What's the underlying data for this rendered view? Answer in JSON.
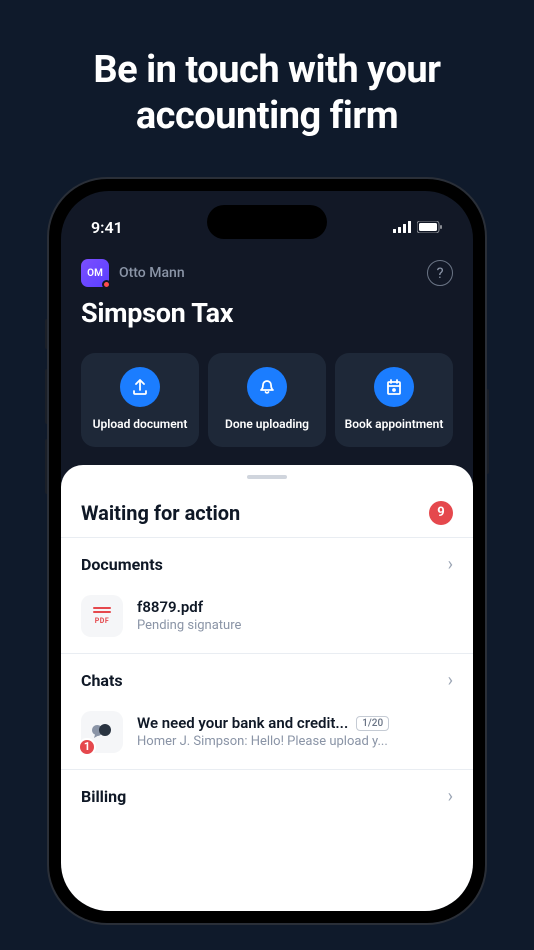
{
  "headline": "Be in touch with your accounting firm",
  "status_bar": {
    "time": "9:41"
  },
  "header": {
    "avatar_initials": "OM",
    "user_name": "Otto Mann",
    "help_glyph": "?",
    "app_title": "Simpson Tax"
  },
  "actions": [
    {
      "id": "upload",
      "label": "Upload document"
    },
    {
      "id": "done",
      "label": "Done uploading"
    },
    {
      "id": "book",
      "label": "Book appointment"
    }
  ],
  "waiting": {
    "title": "Waiting for action",
    "count": "9"
  },
  "documents": {
    "title": "Documents",
    "item": {
      "icon_label": "PDF",
      "name": "f8879.pdf",
      "status": "Pending signature"
    }
  },
  "chats": {
    "title": "Chats",
    "item": {
      "badge": "1",
      "title": "We need your bank and credit...",
      "tag": "1/20",
      "subtitle": "Homer J. Simpson: Hello! Please upload y..."
    }
  },
  "billing": {
    "title": "Billing"
  }
}
